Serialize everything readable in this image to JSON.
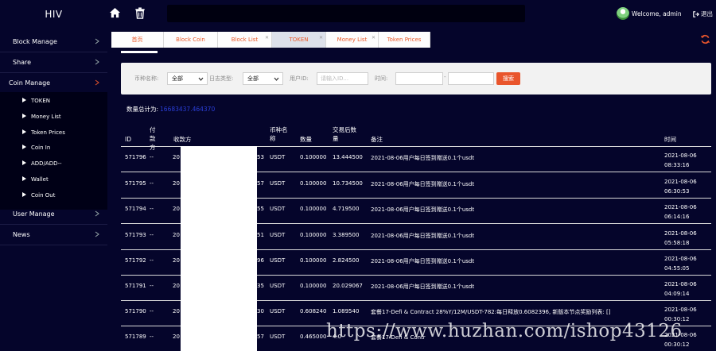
{
  "app": {
    "logo": "HIV"
  },
  "header": {
    "welcome": "Welcome, admin",
    "logout": "退出"
  },
  "sidebar": {
    "items": [
      {
        "label": "Block Manage"
      },
      {
        "label": "Share"
      },
      {
        "label": "Coin Manage"
      },
      {
        "label": "User Manage"
      },
      {
        "label": "News"
      }
    ],
    "submenu": [
      {
        "label": "TOKEN"
      },
      {
        "label": "Money List"
      },
      {
        "label": "Token Prices"
      },
      {
        "label": "Coin In"
      },
      {
        "label": "ADD/ADD--"
      },
      {
        "label": "Wallet"
      },
      {
        "label": "Coin Out"
      }
    ]
  },
  "tabs": [
    {
      "label": "首页"
    },
    {
      "label": "Block Coin"
    },
    {
      "label": "Block List"
    },
    {
      "label": "TOKEN"
    },
    {
      "label": "Money List"
    },
    {
      "label": "Token Prices"
    }
  ],
  "filter": {
    "coin_label": "币种名称:",
    "coin_value": "全部",
    "log_label": "日志类型:",
    "log_value": "全部",
    "user_label": "用户ID:",
    "user_placeholder": "请输入ID...",
    "time_label": "时间:",
    "dash": "-",
    "search_button": "搜索"
  },
  "total": {
    "label": "数量总计为:",
    "value": "16683437.464370"
  },
  "columns": [
    "ID",
    "付款方",
    "收款方",
    "币种名称",
    "数量",
    "交易后数量",
    "备注",
    "时间"
  ],
  "rows": [
    {
      "id": "571796",
      "payer": "--",
      "recv_a": "20",
      "recv_b": "53",
      "coin": "USDT",
      "qty": "0.100000",
      "after": "13.444500",
      "note": "2021-08-06用户每日签到赠送0.1个usdt",
      "date": "2021-08-06",
      "time": "08:33:16"
    },
    {
      "id": "571795",
      "payer": "--",
      "recv_a": "20",
      "recv_b": "57",
      "coin": "USDT",
      "qty": "0.100000",
      "after": "10.734500",
      "note": "2021-08-06用户每日签到赠送0.1个usdt",
      "date": "2021-08-06",
      "time": "06:30:53"
    },
    {
      "id": "571794",
      "payer": "--",
      "recv_a": "20",
      "recv_b": "55",
      "coin": "USDT",
      "qty": "0.100000",
      "after": "4.719500",
      "note": "2021-08-06用户每日签到赠送0.1个usdt",
      "date": "2021-08-06",
      "time": "06:14:16"
    },
    {
      "id": "571793",
      "payer": "--",
      "recv_a": "20",
      "recv_b": "51",
      "coin": "USDT",
      "qty": "0.100000",
      "after": "3.389500",
      "note": "2021-08-06用户每日签到赠送0.1个usdt",
      "date": "2021-08-06",
      "time": "05:58:18"
    },
    {
      "id": "571792",
      "payer": "--",
      "recv_a": "20",
      "recv_b": "96",
      "coin": "USDT",
      "qty": "0.100000",
      "after": "2.824500",
      "note": "2021-08-06用户每日签到赠送0.1个usdt",
      "date": "2021-08-06",
      "time": "04:55:05"
    },
    {
      "id": "571791",
      "payer": "--",
      "recv_a": "20",
      "recv_b": "35",
      "coin": "USDT",
      "qty": "0.100000",
      "after": "20.029067",
      "note": "2021-08-06用户每日签到赠送0.1个usdt",
      "date": "2021-08-06",
      "time": "04:09:14"
    },
    {
      "id": "571790",
      "payer": "--",
      "recv_a": "20",
      "recv_b": "30",
      "coin": "USDT",
      "qty": "0.608240",
      "after": "1.089540",
      "note": "套餐17-Defi & Contract 28%Y/12M/USDT-782:每日释放0.6082396, 新版本节点奖励列表: []",
      "date": "2021-08-06",
      "time": "00:30:12"
    },
    {
      "id": "571789",
      "payer": "--",
      "recv_a": "20",
      "recv_b": "57",
      "coin": "USDT",
      "qty": "0.465000",
      "after": "4.0",
      "note": "套餐17-Defi & Contr",
      "date": "2021-08-06",
      "time": "00:30:12"
    }
  ],
  "watermark": "https://www.huzhan.com/ishop43126",
  "colors": {
    "accent": "#e9552c",
    "background": "#05052b",
    "total_value": "#2b3fd9"
  },
  "icons": {
    "home": "home-icon",
    "trash": "trash-icon",
    "refresh": "refresh-icon"
  }
}
